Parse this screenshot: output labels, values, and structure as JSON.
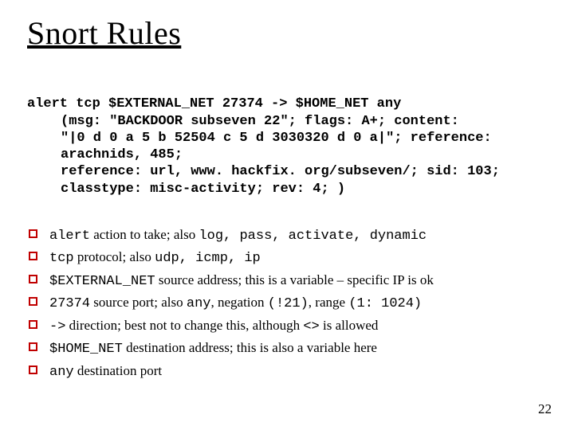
{
  "title": "Snort Rules",
  "code": {
    "line1": "alert tcp $EXTERNAL_NET 27374 -> $HOME_NET any",
    "line2": "(msg: \"BACKDOOR subseven 22\"; flags: A+; content:",
    "line3": "\"|0 d 0 a 5 b 52504 c 5 d 3030320 d 0 a|\"; reference: arachnids, 485;",
    "line4": "reference: url, www. hackfix. org/subseven/; sid: 103;",
    "line5": "classtype: misc-activity; rev: 4; )"
  },
  "bullets": [
    {
      "kw": "alert",
      "t1": " action to take; also ",
      "mono2": "log, pass, activate, dynamic",
      "t2": ""
    },
    {
      "kw": "tcp",
      "t1": " protocol; also ",
      "mono2": "udp, icmp, ip",
      "t2": ""
    },
    {
      "kw": "$EXTERNAL_NET",
      "t1": " source address; this is a variable – specific IP is ok",
      "mono2": "",
      "t2": ""
    },
    {
      "kw": "27374",
      "t1": " source port; also ",
      "mono2": "any",
      "t2": ", negation ",
      "mono3": "(!21)",
      "t3": ", range ",
      "mono4": "(1: 1024)"
    },
    {
      "kw": "->",
      "t1": " direction; best not to change this, although ",
      "mono2": "<>",
      "t2": " is allowed"
    },
    {
      "kw": "$HOME_NET",
      "t1": " destination address; this is also a variable here",
      "mono2": "",
      "t2": ""
    },
    {
      "kw": "any",
      "t1": " destination port",
      "mono2": "",
      "t2": ""
    }
  ],
  "pagenum": "22"
}
